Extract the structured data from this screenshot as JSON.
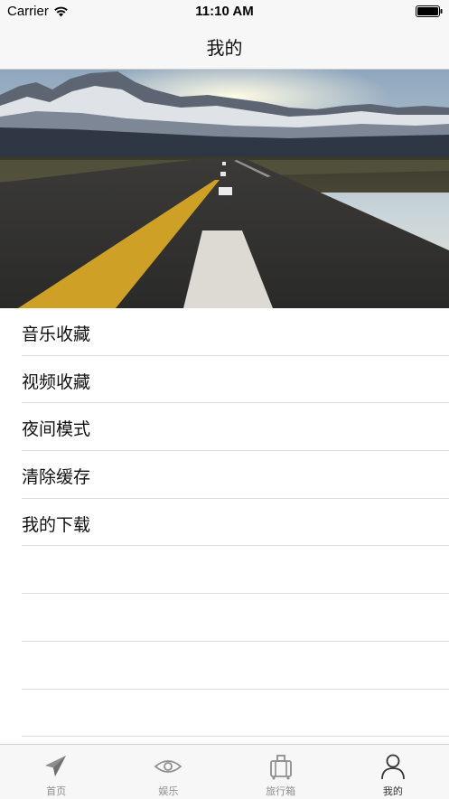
{
  "status_bar": {
    "carrier": "Carrier",
    "time": "11:10 AM"
  },
  "nav": {
    "title": "我的"
  },
  "menu": {
    "items": [
      {
        "label": "音乐收藏"
      },
      {
        "label": "视频收藏"
      },
      {
        "label": "夜间模式"
      },
      {
        "label": "清除缓存"
      },
      {
        "label": "我的下载"
      }
    ]
  },
  "tabs": [
    {
      "label": "首页",
      "icon": "paper-plane-icon",
      "active": false
    },
    {
      "label": "娱乐",
      "icon": "eye-icon",
      "active": false
    },
    {
      "label": "旅行箱",
      "icon": "suitcase-icon",
      "active": false
    },
    {
      "label": "我的",
      "icon": "person-icon",
      "active": true
    }
  ],
  "colors": {
    "bar_background": "#f7f7f7",
    "separator": "#dedede",
    "tab_inactive": "#8e8e8e",
    "tab_active": "#333333"
  }
}
